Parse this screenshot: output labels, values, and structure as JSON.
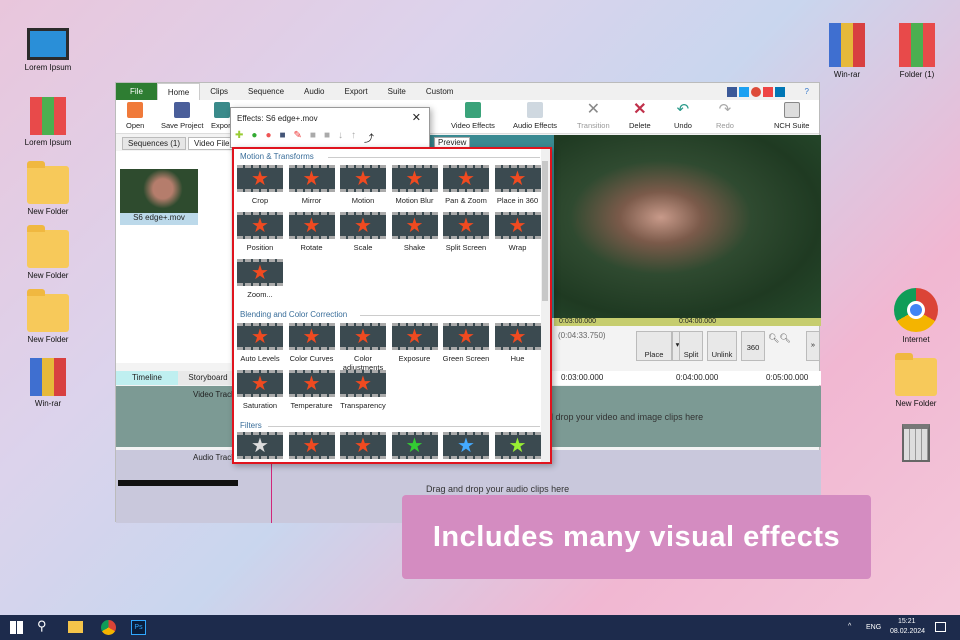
{
  "desktop": {
    "left_icons": [
      "Lorem Ipsum",
      "Lorem Ipsum",
      "New Folder",
      "New Folder",
      "New Folder",
      "Win-rar"
    ],
    "right_icons": [
      "Win-rar",
      "Folder (1)",
      "Internet",
      "New Folder"
    ]
  },
  "app": {
    "tabs": [
      "File",
      "Home",
      "Clips",
      "Sequence",
      "Audio",
      "Export",
      "Suite",
      "Custom"
    ],
    "ribbon": [
      "Open",
      "Save Project",
      "Export",
      "Video Effects",
      "Audio Effects",
      "Transition",
      "Delete",
      "Undo",
      "Redo",
      "NCH Suite"
    ],
    "bin_tabs": [
      "Sequences (1)",
      "Video Files"
    ],
    "clip_name": "S6 edge+.mov",
    "preview_tab": "Preview",
    "preview_ruler": [
      "0:03:00.000",
      "0:04:00.000"
    ],
    "duration": "(0:04:33.750)",
    "buttons": [
      "Place",
      "Split",
      "Unlink",
      "360"
    ],
    "timeline_tabs": [
      "Timeline",
      "Storyboard"
    ],
    "timeline_ruler": [
      "0:03:00.000",
      "0:04:00.000",
      "0:05:00.000"
    ],
    "video_track": "Video Track",
    "audio_track": "Audio Track",
    "video_drop": "Drag and drop your video and image clips here",
    "audio_drop": "Drag and drop your audio clips here"
  },
  "effects": {
    "title": "Effects: S6 edge+.mov",
    "sections": [
      "Motion & Transforms",
      "Blending and Color Correction",
      "Filters"
    ],
    "motion": [
      "Crop",
      "Mirror",
      "Motion",
      "Motion Blur",
      "Pan & Zoom",
      "Place in 360",
      "Position",
      "Rotate",
      "Scale",
      "Shake",
      "Split Screen",
      "Wrap",
      "Zoom..."
    ],
    "blending": [
      "Auto Levels",
      "Color Curves",
      "Color adjustments",
      "Exposure",
      "Green Screen",
      "Hue",
      "Saturation",
      "Temperature",
      "Transparency"
    ]
  },
  "banner": "Includes many visual effects",
  "taskbar": {
    "lang": "ENG",
    "time": "15:21",
    "date": "08.02.2024"
  }
}
